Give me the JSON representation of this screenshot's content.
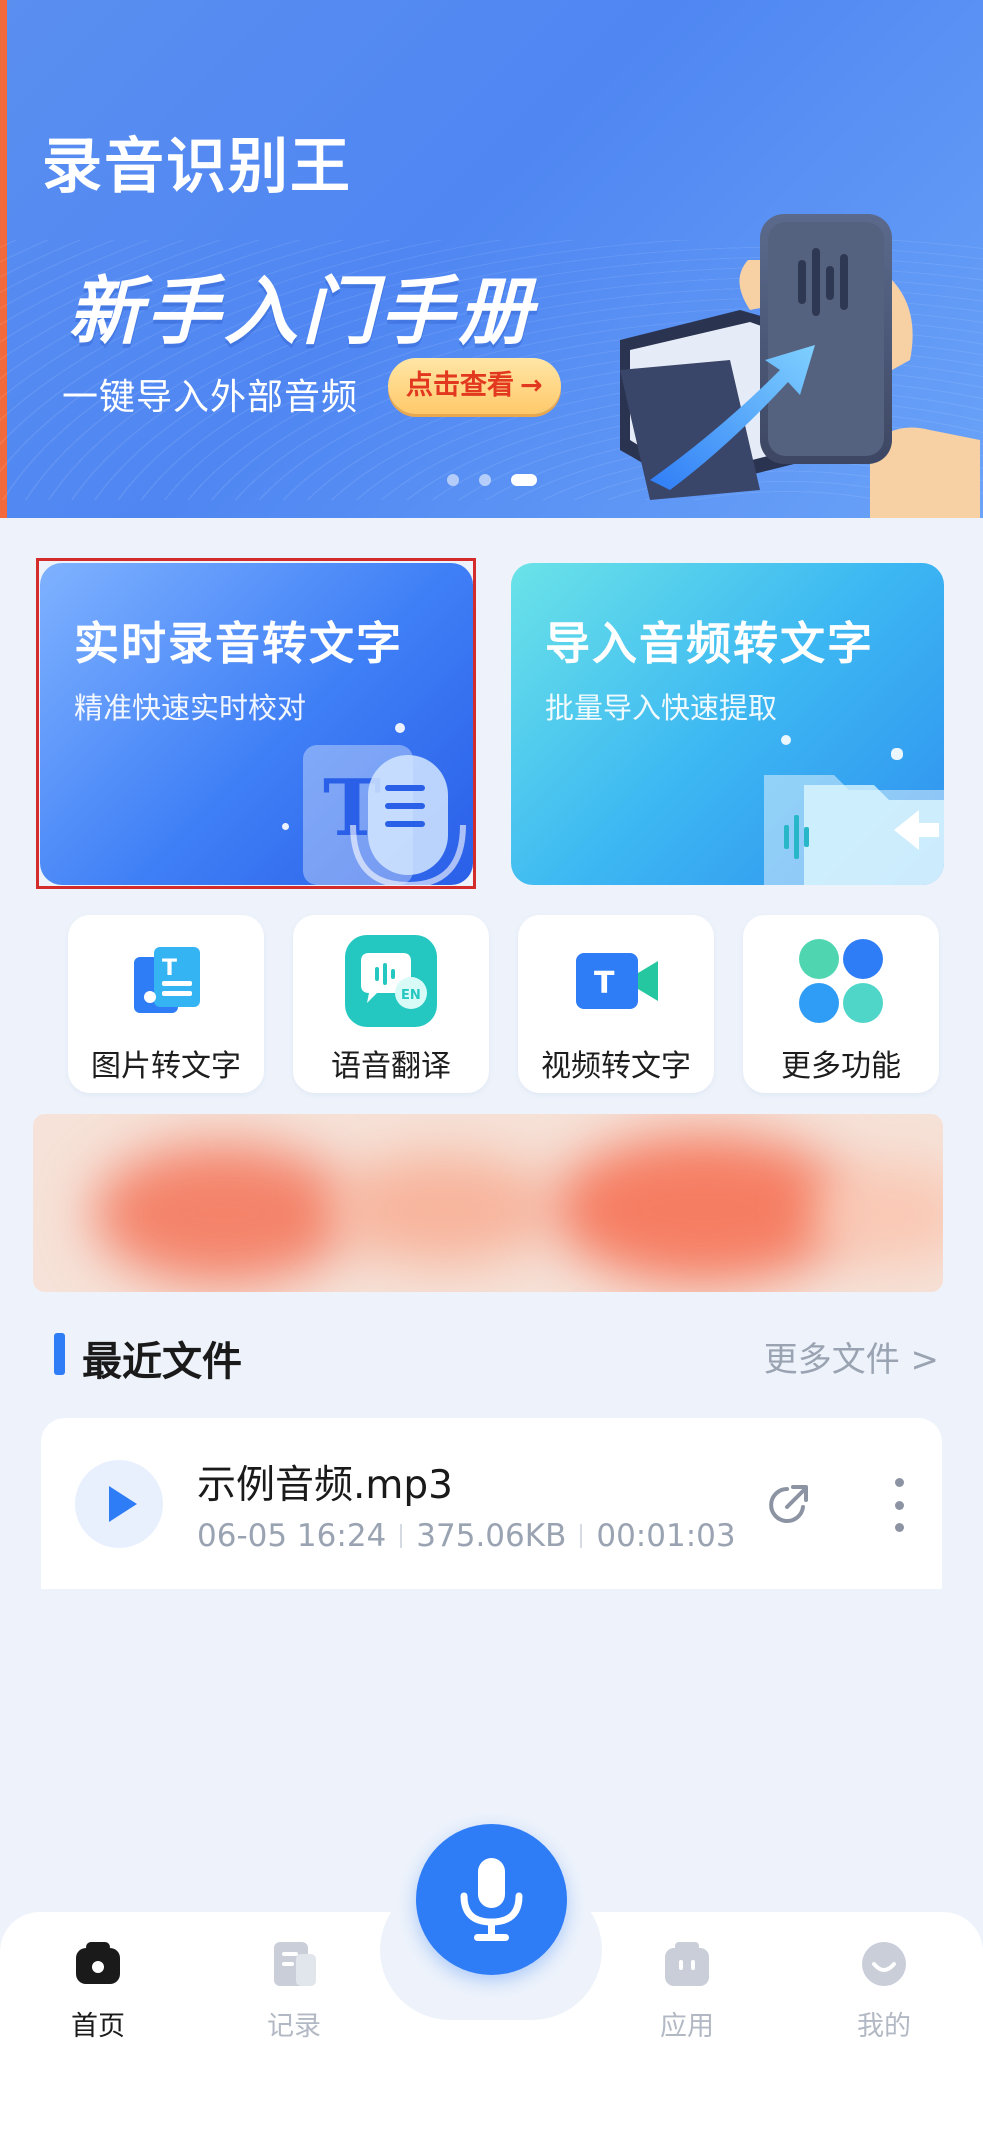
{
  "banner": {
    "app_title": "录音识别王",
    "headline": "新手入门手册",
    "subline": "一键导入外部音频",
    "cta_label": "点击查看",
    "cta_arrow": "→",
    "page_indicator": {
      "total": 3,
      "active": 3
    }
  },
  "cards": {
    "realtime": {
      "title": "实时录音转文字",
      "subtitle": "精准快速实时校对"
    },
    "import": {
      "title": "导入音频转文字",
      "subtitle": "批量导入快速提取"
    }
  },
  "tools": [
    {
      "label": "图片转文字",
      "icon": "image-to-text-icon"
    },
    {
      "label": "语音翻译",
      "icon": "voice-translate-icon"
    },
    {
      "label": "视频转文字",
      "icon": "video-to-text-icon"
    },
    {
      "label": "更多功能",
      "icon": "more-features-icon"
    }
  ],
  "recent": {
    "title": "最近文件",
    "more_link": "更多文件 >",
    "files": [
      {
        "name": "示例音频.mp3",
        "date": "06-05 16:24",
        "size": "375.06KB",
        "duration": "00:01:03"
      }
    ]
  },
  "nav": {
    "items": [
      {
        "label": "首页",
        "active": true
      },
      {
        "label": "记录",
        "active": false
      },
      {
        "label": "应用",
        "active": false
      },
      {
        "label": "我的",
        "active": false
      }
    ]
  },
  "colors": {
    "primary": "#2f7df6",
    "page_bg": "#eef3fb",
    "cta_text": "#e2381f",
    "muted_text": "#9aa3b2",
    "highlight_border": "#d42b2b"
  }
}
